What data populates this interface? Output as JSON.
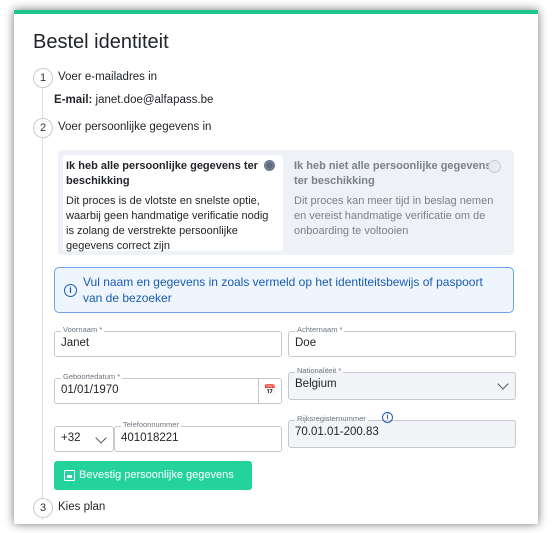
{
  "page": {
    "title": "Bestel identiteit",
    "accent_color": "#1fc58f"
  },
  "steps": [
    {
      "number": "1",
      "label": "Voer e-mailadres in"
    },
    {
      "number": "2",
      "label": "Voer persoonlijke gegevens in"
    },
    {
      "number": "3",
      "label": "Kies plan"
    }
  ],
  "email": {
    "label": "E-mail:",
    "value": "janet.doe@alfapass.be"
  },
  "choices": [
    {
      "title": "Ik heb alle persoonlijke gegevens ter beschikking",
      "description": "Dit proces is de vlotste en snelste optie, waarbij geen handmatige verificatie nodig is zolang de verstrekte persoonlijke gegevens correct zijn",
      "selected": true
    },
    {
      "title": "Ik heb niet alle persoonlijke gegevens ter beschikking",
      "description": "Dit proces kan meer tijd in beslag nemen en vereist handmatige verificatie om de onboarding te voltooien",
      "selected": false
    }
  ],
  "info_message": "Vul naam en gegevens in zoals vermeld op het identiteitsbewijs of paspoort van de bezoeker",
  "form": {
    "first_name": {
      "label": "Voornaam *",
      "value": "Janet"
    },
    "last_name": {
      "label": "Achternaam *",
      "value": "Doe"
    },
    "birth_date": {
      "label": "Geboortedatum *",
      "value": "01/01/1970"
    },
    "nationality": {
      "label": "Nationaliteit *",
      "value": "Belgium"
    },
    "phone_prefix": {
      "value": "+32"
    },
    "phone": {
      "label": "Telefoonnummer",
      "value": "401018221"
    },
    "national_register": {
      "label": "Rijksregisternummer",
      "value": "70.01.01-200.83"
    }
  },
  "save_button": {
    "label": "Bevestig persoonlijke gegevens",
    "icon": "save-icon",
    "color": "#24d39c"
  }
}
